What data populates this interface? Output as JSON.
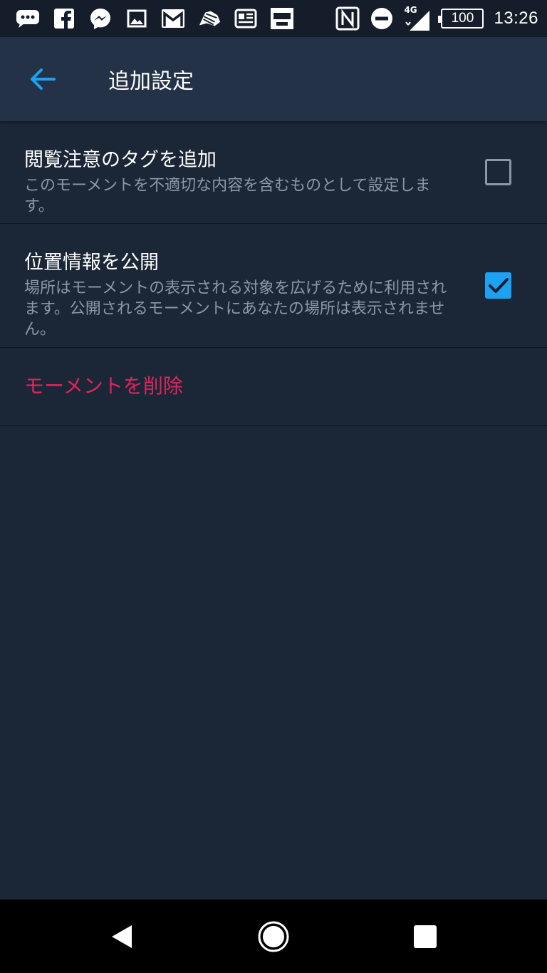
{
  "status_bar": {
    "icons_left": [
      "chat-bubble-icon",
      "facebook-icon",
      "messenger-icon",
      "image-icon",
      "gmail-icon",
      "zebra-icon",
      "news-icon",
      "rikunabi-app-icon"
    ],
    "nfc_icon": "nfc-icon",
    "dnd_icon": "do-not-disturb-icon",
    "network": "4G",
    "battery": "100",
    "time": "13:26"
  },
  "app_bar": {
    "back_icon": "arrow-left-icon",
    "title": "追加設定",
    "accent": "#1da1f2"
  },
  "settings": [
    {
      "title": "閲覧注意のタグを追加",
      "description": "このモーメントを不適切な内容を含むものとして設定します。",
      "checked": false
    },
    {
      "title": "位置情報を公開",
      "description": "場所はモーメントの表示される対象を広げるために利用されます。公開されるモーメントにあなたの場所は表示されません。",
      "checked": true
    }
  ],
  "delete": {
    "label": "モーメントを削除",
    "color": "#e0245e"
  },
  "nav_bar": {
    "back_icon": "triangle-back-icon",
    "home_icon": "circle-home-icon",
    "recents_icon": "square-recents-icon"
  }
}
